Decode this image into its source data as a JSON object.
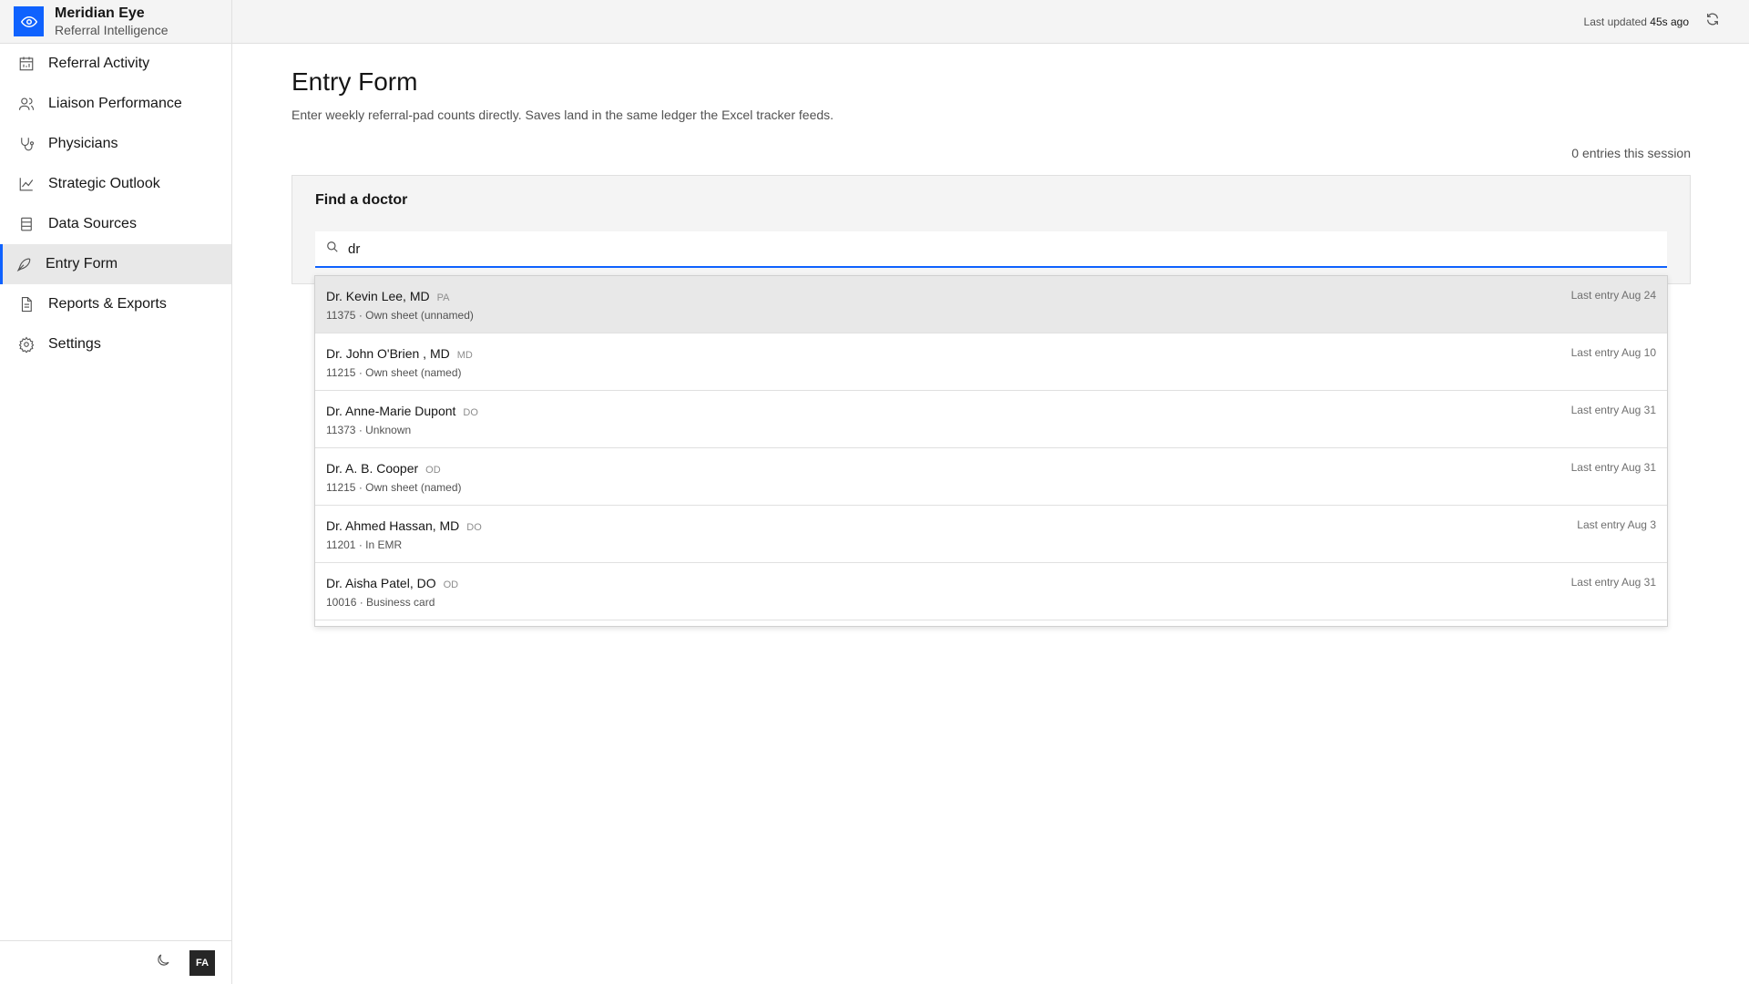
{
  "brand": {
    "name": "Meridian Eye",
    "subtitle": "Referral Intelligence",
    "icon": "eye-icon",
    "accent": "#0f62fe"
  },
  "sidebar": {
    "items": [
      {
        "label": "Referral Activity",
        "icon": "calendar-chart-icon",
        "active": false
      },
      {
        "label": "Liaison Performance",
        "icon": "users-icon",
        "active": false
      },
      {
        "label": "Physicians",
        "icon": "stethoscope-icon",
        "active": false
      },
      {
        "label": "Strategic Outlook",
        "icon": "line-chart-icon",
        "active": false
      },
      {
        "label": "Data Sources",
        "icon": "database-icon",
        "active": false
      },
      {
        "label": "Entry Form",
        "icon": "pen-icon",
        "active": true
      },
      {
        "label": "Reports & Exports",
        "icon": "document-icon",
        "active": false
      },
      {
        "label": "Settings",
        "icon": "gear-icon",
        "active": false
      }
    ],
    "footer": {
      "theme_icon": "moon-icon",
      "avatar_initials": "FA"
    }
  },
  "topbar": {
    "updated_prefix": "Last updated",
    "updated_value": "45s ago",
    "refresh_icon": "refresh-icon"
  },
  "main": {
    "title": "Entry Form",
    "description": "Enter weekly referral-pad counts directly. Saves land in the same ledger the Excel tracker feeds.",
    "session_count": "0 entries this session",
    "finder": {
      "title": "Find a doctor",
      "search_value": "dr"
    }
  },
  "results": [
    {
      "name": "Dr. Kevin Lee, MD",
      "cred": "PA",
      "sub": "11375 · Own sheet (unnamed)",
      "last": "Last entry Aug 24",
      "highlight": true
    },
    {
      "name": "Dr. John O'Brien , MD",
      "cred": "MD",
      "sub": "11215 · Own sheet (named)",
      "last": "Last entry Aug 10",
      "highlight": false
    },
    {
      "name": "Dr. Anne-Marie Dupont",
      "cred": "DO",
      "sub": "11373 · Unknown",
      "last": "Last entry Aug 31",
      "highlight": false
    },
    {
      "name": "Dr. A. B. Cooper",
      "cred": "OD",
      "sub": "11215 · Own sheet (named)",
      "last": "Last entry Aug 31",
      "highlight": false
    },
    {
      "name": "Dr. Ahmed Hassan, MD",
      "cred": "DO",
      "sub": "11201 · In EMR",
      "last": "Last entry Aug 3",
      "highlight": false
    },
    {
      "name": "Dr. Aisha Patel, DO",
      "cred": "OD",
      "sub": "10016 · Business card",
      "last": "Last entry Aug 31",
      "highlight": false
    }
  ]
}
